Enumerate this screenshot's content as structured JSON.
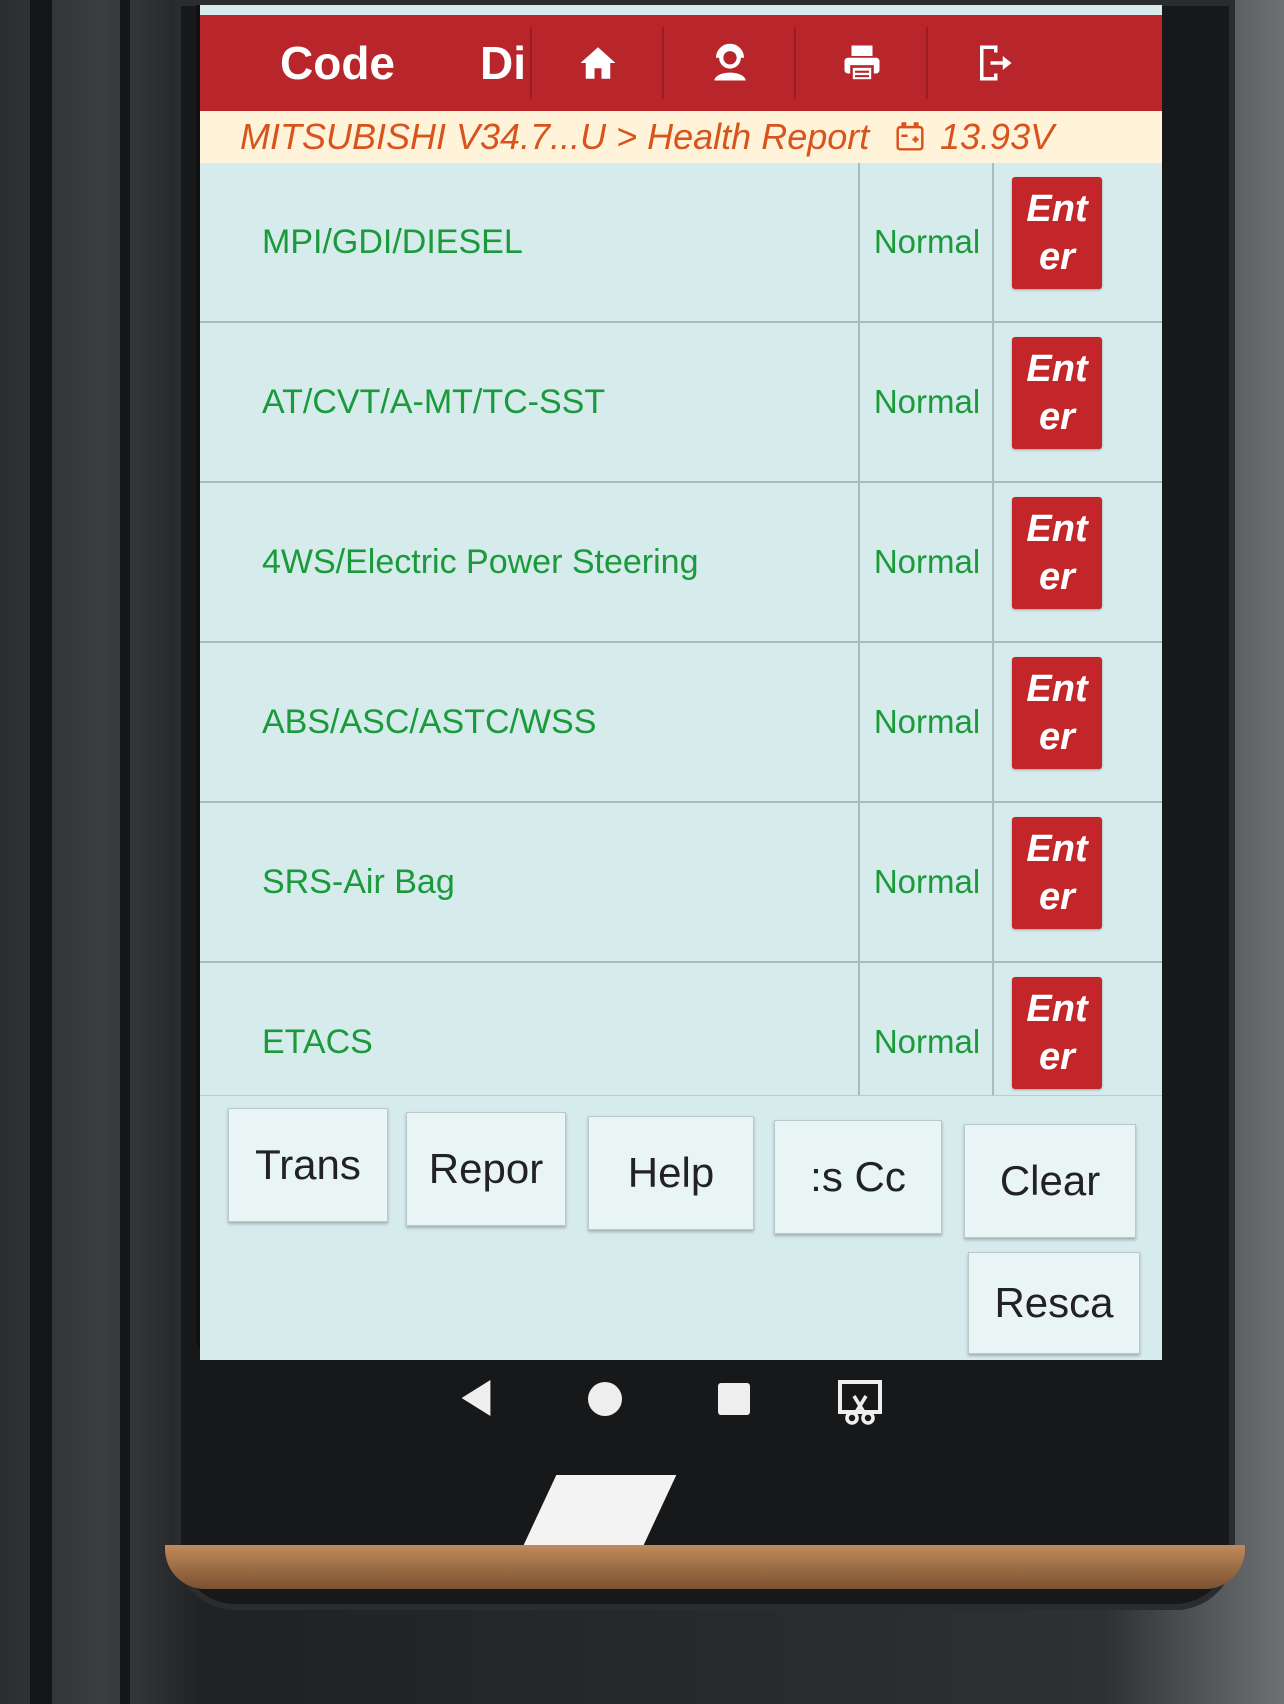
{
  "topbar": {
    "code_label": "Code",
    "di_label": "Di",
    "icons": [
      "home-icon",
      "technician-icon",
      "printer-icon",
      "exit-icon"
    ],
    "color": "#b8252a"
  },
  "breadcrumb": {
    "path": "MITSUBISHI V34.7...U > Health Report",
    "icon": "battery-icon",
    "voltage": "13.93V"
  },
  "rows": [
    {
      "name": "MPI/GDI/DIESEL",
      "status": "Normal",
      "enter": "Ent\ner"
    },
    {
      "name": "AT/CVT/A-MT/TC-SST",
      "status": "Normal",
      "enter": "Ent\ner"
    },
    {
      "name": "4WS/Electric Power Steering",
      "status": "Normal",
      "enter": "Ent\ner"
    },
    {
      "name": "ABS/ASC/ASTC/WSS",
      "status": "Normal",
      "enter": "Ent\ner"
    },
    {
      "name": "SRS-Air Bag",
      "status": "Normal",
      "enter": "Ent\ner"
    },
    {
      "name": "ETACS",
      "status": "Normal",
      "enter": "Ent\ner"
    }
  ],
  "bottom_buttons": {
    "trans": "Trans",
    "report": "Repor",
    "help": "Help",
    "codes": ":s  Cc",
    "clear": "Clear",
    "rescan": "Resca"
  },
  "colors": {
    "accent_red": "#c2262b",
    "status_green": "#1a9a3a",
    "breadcrumb_orange": "#d9531c",
    "background": "#d6ebec"
  }
}
